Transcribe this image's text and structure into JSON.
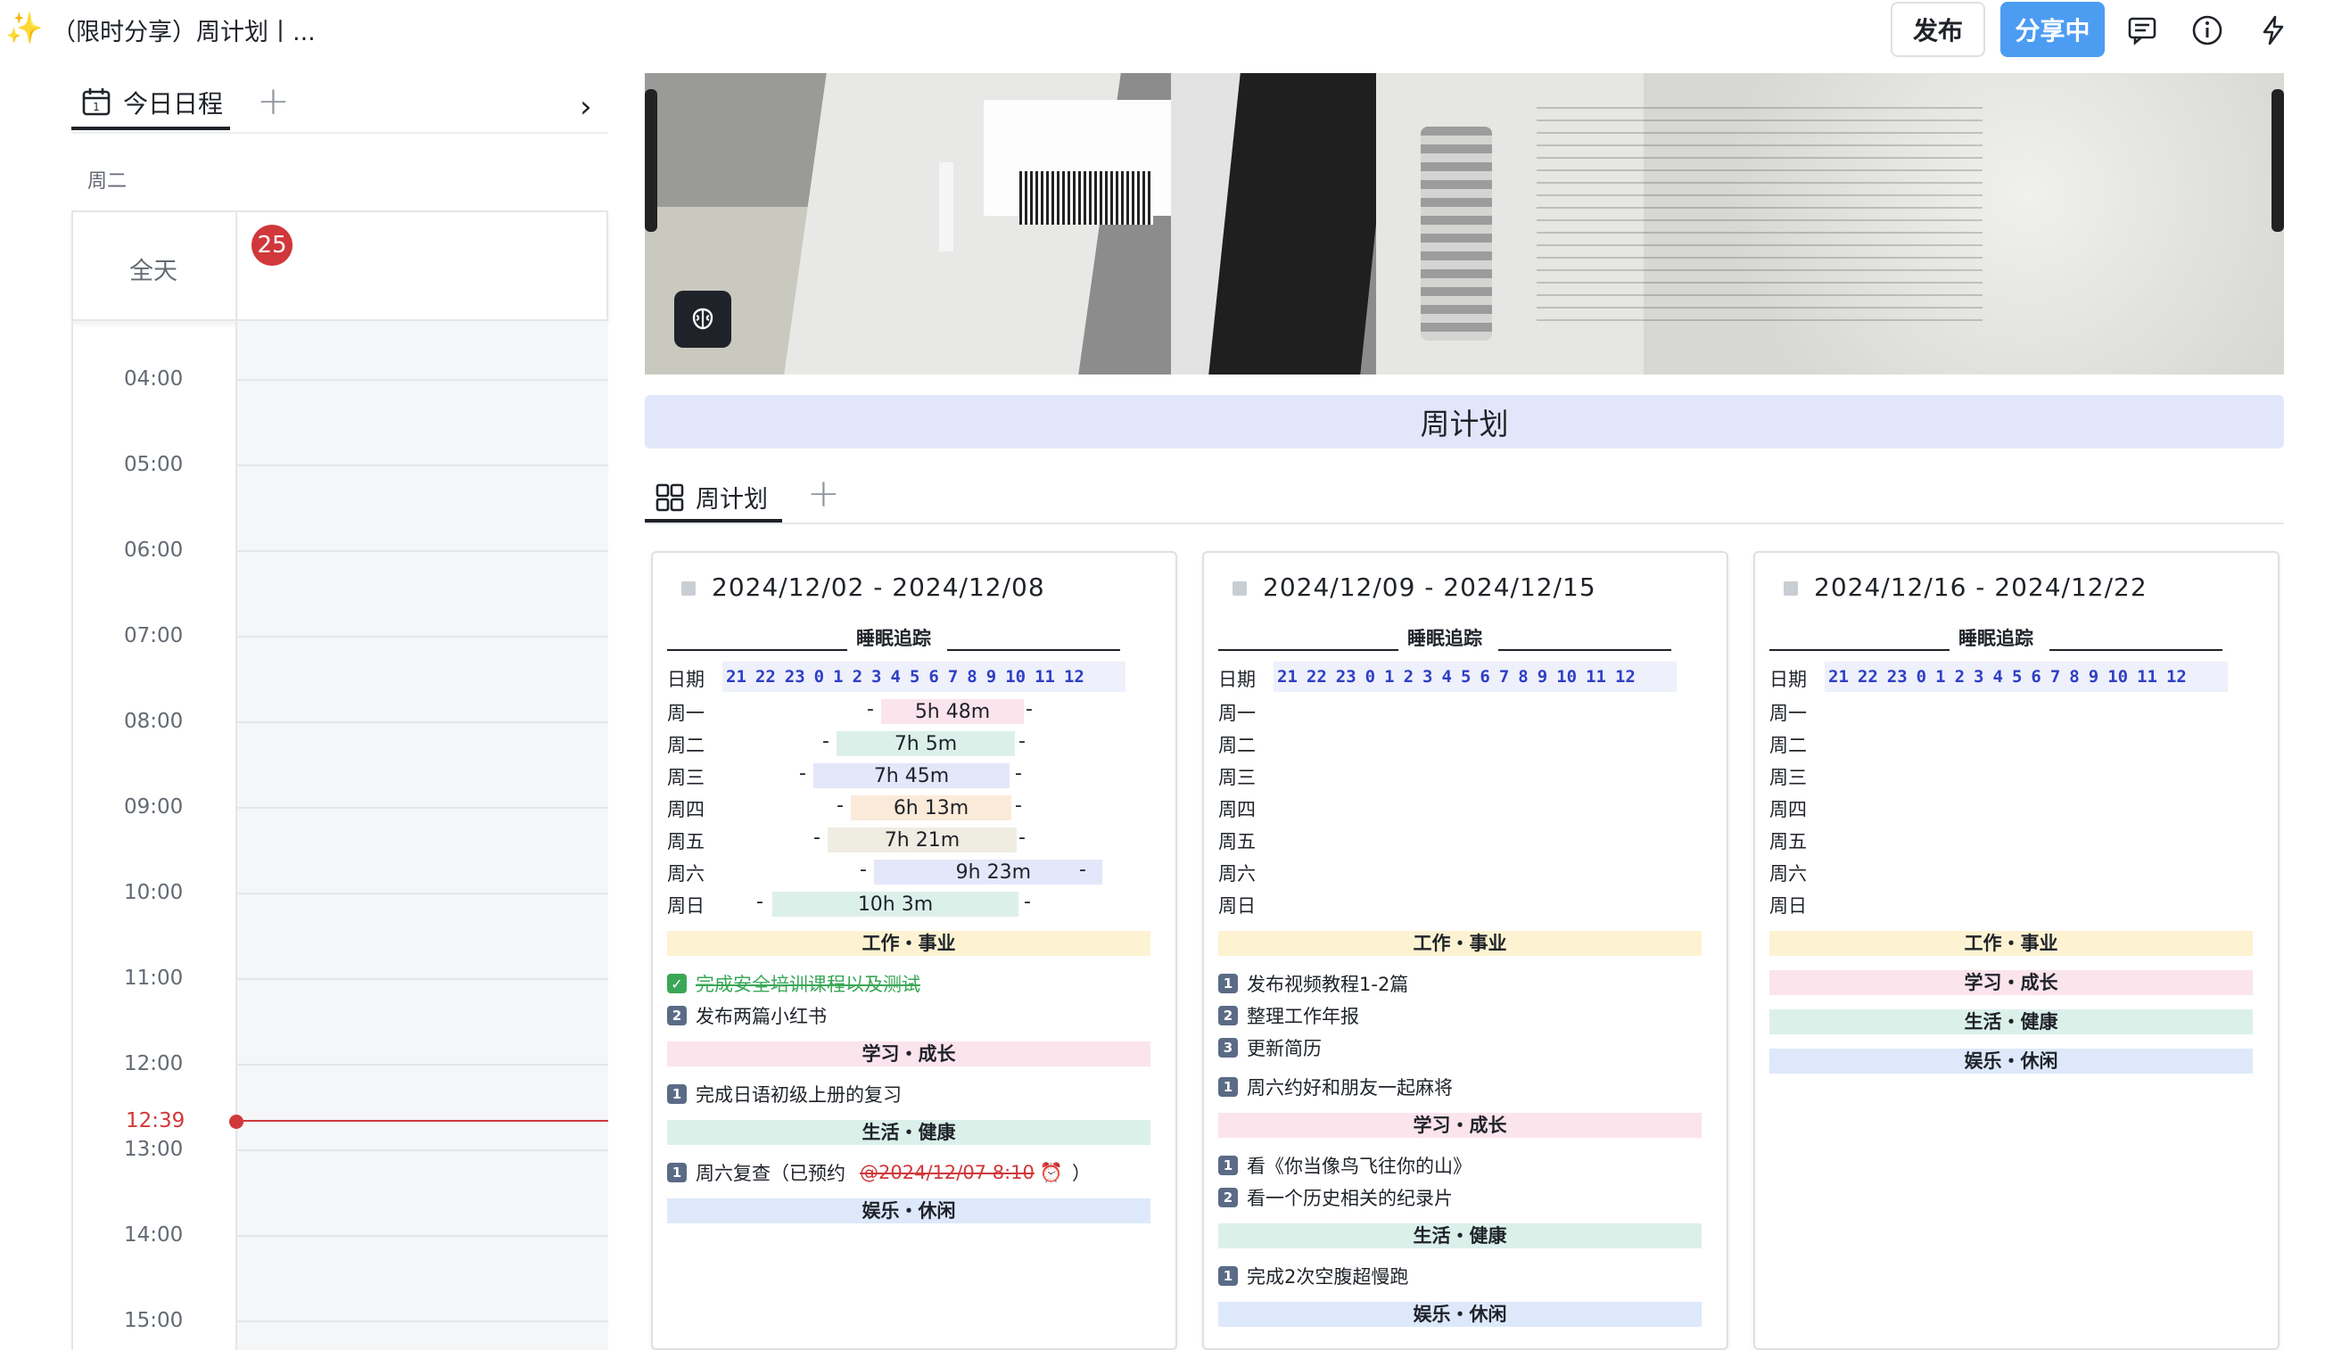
{
  "header": {
    "doc_title": "（限时分享）周计划丨...",
    "publish_label": "发布",
    "share_label": "分享中",
    "icons": [
      "comment-icon",
      "info-icon",
      "lightning-icon"
    ]
  },
  "calendar": {
    "tab_label": "今日日程",
    "weekday": "周二",
    "allday_label": "全天",
    "date_badge": "25",
    "hours": [
      "04:00",
      "05:00",
      "06:00",
      "07:00",
      "08:00",
      "09:00",
      "10:00",
      "11:00",
      "12:00",
      "13:00",
      "14:00",
      "15:00"
    ],
    "now_label": "12:39"
  },
  "page": {
    "title": "周计划",
    "view_tab": "周计划"
  },
  "ruler": [
    "21",
    "22",
    "23",
    "0",
    "1",
    "2",
    "3",
    "4",
    "5",
    "6",
    "7",
    "8",
    "9",
    "10",
    "11",
    "12"
  ],
  "weeks": [
    {
      "range": "2024/12/02 - 2024/12/08",
      "sleep_title": "睡眠追踪",
      "date_label": "日期",
      "days": [
        "周一",
        "周二",
        "周三",
        "周四",
        "周五",
        "周六",
        "周日"
      ],
      "sleep": [
        "5h 48m",
        "7h 5m",
        "7h 45m",
        "6h 13m",
        "7h 21m",
        "9h 23m",
        "10h 3m"
      ],
      "work_title": "工作・事业",
      "work_tasks": [
        "完成安全培训课程以及测试",
        "发布两篇小红书"
      ],
      "study_title": "学习・成长",
      "study_tasks": [
        "完成日语初级上册的复习"
      ],
      "life_title": "生活・健康",
      "life_tasks_prefix": "周六复查（已预约",
      "life_tasks_mention": "@2024/12/07 8:10",
      "life_tasks_suffix": "）",
      "fun_title": "娱乐・休闲"
    },
    {
      "range": "2024/12/09 - 2024/12/15",
      "sleep_title": "睡眠追踪",
      "date_label": "日期",
      "days": [
        "周一",
        "周二",
        "周三",
        "周四",
        "周五",
        "周六",
        "周日"
      ],
      "work_title": "工作・事业",
      "work_tasks": [
        "发布视频教程1-2篇",
        "整理工作年报",
        "更新简历",
        "周六约好和朋友一起麻将"
      ],
      "study_title": "学习・成长",
      "study_tasks": [
        "看《你当像鸟飞往你的山》",
        "看一个历史相关的纪录片"
      ],
      "life_title": "生活・健康",
      "life_tasks": [
        "完成2次空腹超慢跑"
      ],
      "fun_title": "娱乐・休闲"
    },
    {
      "range": "2024/12/16 - 2024/12/22",
      "sleep_title": "睡眠追踪",
      "date_label": "日期",
      "days": [
        "周一",
        "周二",
        "周三",
        "周四",
        "周五",
        "周六",
        "周日"
      ],
      "work_title": "工作・事业",
      "study_title": "学习・成长",
      "life_title": "生活・健康",
      "fun_title": "娱乐・休闲"
    }
  ],
  "colors": {
    "accent": "#4c9cf2",
    "now_red": "#d0383b",
    "title_bar": "#e2e6fa"
  }
}
